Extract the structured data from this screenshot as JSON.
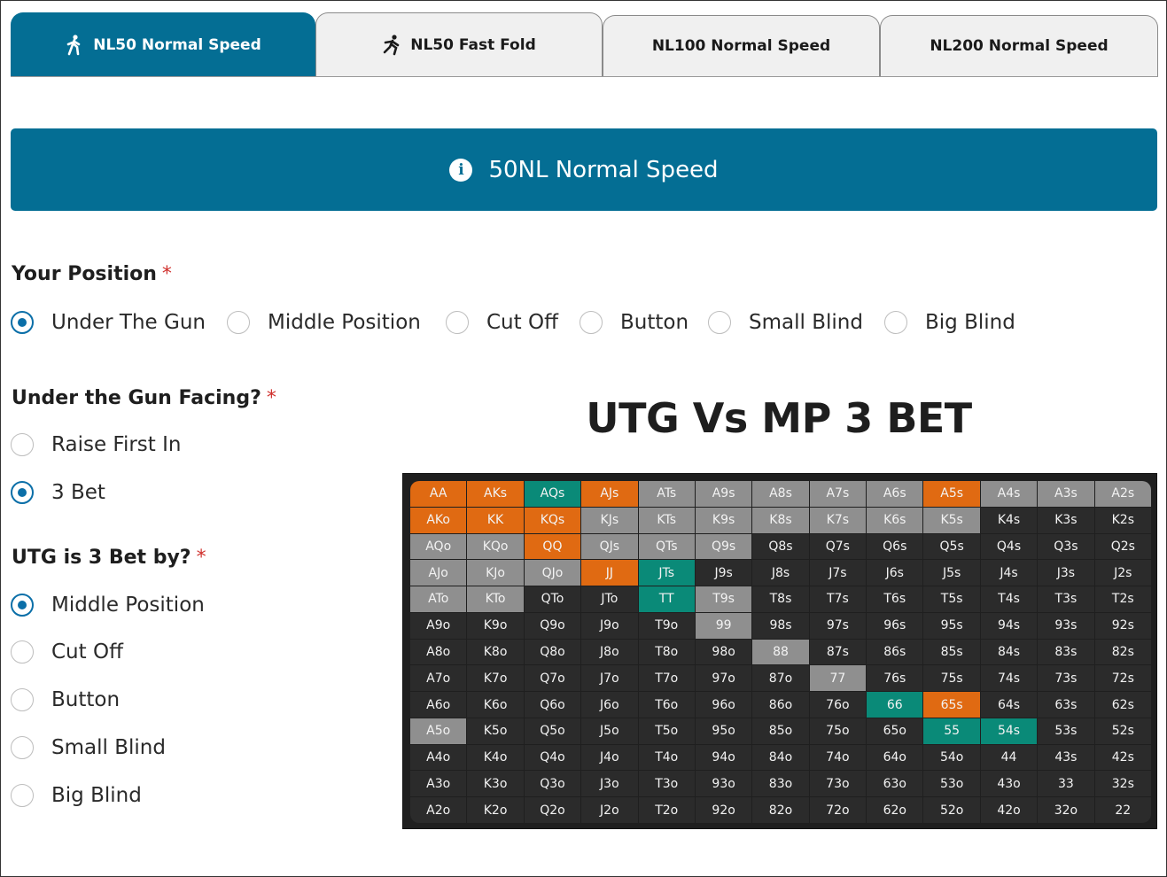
{
  "tabs": [
    {
      "label": "NL50 Normal Speed",
      "icon": "walking-person-icon",
      "active": true
    },
    {
      "label": "NL50 Fast Fold",
      "icon": "running-person-icon",
      "active": false
    },
    {
      "label": "NL100 Normal Speed",
      "active": false
    },
    {
      "label": "NL200 Normal Speed",
      "active": false
    }
  ],
  "banner": {
    "text": "50NL Normal Speed",
    "icon": "info-icon"
  },
  "position": {
    "label": "Your Position",
    "required": "*",
    "options": [
      "Under The Gun",
      "Middle Position",
      "Cut Off",
      "Button",
      "Small Blind",
      "Big Blind"
    ],
    "selected": "Under The Gun"
  },
  "facing": {
    "label": "Under the Gun Facing?",
    "required": "*",
    "options": [
      "Raise First In",
      "3 Bet"
    ],
    "selected": "3 Bet"
  },
  "threebet_by": {
    "label": "UTG is 3 Bet by?",
    "required": "*",
    "options": [
      "Middle Position",
      "Cut Off",
      "Button",
      "Small Blind",
      "Big Blind"
    ],
    "selected": "Middle Position"
  },
  "chart": {
    "title": "UTG Vs MP 3 BET",
    "colors": {
      "default": "#2b2b2b",
      "gray": "#8f8f8f",
      "orange": "#e06a12",
      "teal": "#0a8a78"
    },
    "rows": [
      [
        "AA",
        "AKs",
        "AQs",
        "AJs",
        "ATs",
        "A9s",
        "A8s",
        "A7s",
        "A6s",
        "A5s",
        "A4s",
        "A3s",
        "A2s"
      ],
      [
        "AKo",
        "KK",
        "KQs",
        "KJs",
        "KTs",
        "K9s",
        "K8s",
        "K7s",
        "K6s",
        "K5s",
        "K4s",
        "K3s",
        "K2s"
      ],
      [
        "AQo",
        "KQo",
        "QQ",
        "QJs",
        "QTs",
        "Q9s",
        "Q8s",
        "Q7s",
        "Q6s",
        "Q5s",
        "Q4s",
        "Q3s",
        "Q2s"
      ],
      [
        "AJo",
        "KJo",
        "QJo",
        "JJ",
        "JTs",
        "J9s",
        "J8s",
        "J7s",
        "J6s",
        "J5s",
        "J4s",
        "J3s",
        "J2s"
      ],
      [
        "ATo",
        "KTo",
        "QTo",
        "JTo",
        "TT",
        "T9s",
        "T8s",
        "T7s",
        "T6s",
        "T5s",
        "T4s",
        "T3s",
        "T2s"
      ],
      [
        "A9o",
        "K9o",
        "Q9o",
        "J9o",
        "T9o",
        "99",
        "98s",
        "97s",
        "96s",
        "95s",
        "94s",
        "93s",
        "92s"
      ],
      [
        "A8o",
        "K8o",
        "Q8o",
        "J8o",
        "T8o",
        "98o",
        "88",
        "87s",
        "86s",
        "85s",
        "84s",
        "83s",
        "82s"
      ],
      [
        "A7o",
        "K7o",
        "Q7o",
        "J7o",
        "T7o",
        "97o",
        "87o",
        "77",
        "76s",
        "75s",
        "74s",
        "73s",
        "72s"
      ],
      [
        "A6o",
        "K6o",
        "Q6o",
        "J6o",
        "T6o",
        "96o",
        "86o",
        "76o",
        "66",
        "65s",
        "64s",
        "63s",
        "62s"
      ],
      [
        "A5o",
        "K5o",
        "Q5o",
        "J5o",
        "T5o",
        "95o",
        "85o",
        "75o",
        "65o",
        "55",
        "54s",
        "53s",
        "52s"
      ],
      [
        "A4o",
        "K4o",
        "Q4o",
        "J4o",
        "T4o",
        "94o",
        "84o",
        "74o",
        "64o",
        "54o",
        "44",
        "43s",
        "42s"
      ],
      [
        "A3o",
        "K3o",
        "Q3o",
        "J3o",
        "T3o",
        "93o",
        "83o",
        "73o",
        "63o",
        "53o",
        "43o",
        "33",
        "32s"
      ],
      [
        "A2o",
        "K2o",
        "Q2o",
        "J2o",
        "T2o",
        "92o",
        "82o",
        "72o",
        "62o",
        "52o",
        "42o",
        "32o",
        "22"
      ]
    ],
    "cell_colors": [
      [
        "orange",
        "orange",
        "teal",
        "orange",
        "gray",
        "gray",
        "gray",
        "gray",
        "gray",
        "orange",
        "gray",
        "gray",
        "gray"
      ],
      [
        "orange",
        "orange",
        "orange",
        "gray",
        "gray",
        "gray",
        "gray",
        "gray",
        "gray",
        "gray",
        "default",
        "default",
        "default"
      ],
      [
        "gray",
        "gray",
        "orange",
        "gray",
        "gray",
        "gray",
        "default",
        "default",
        "default",
        "default",
        "default",
        "default",
        "default"
      ],
      [
        "gray",
        "gray",
        "gray",
        "orange",
        "teal",
        "default",
        "default",
        "default",
        "default",
        "default",
        "default",
        "default",
        "default"
      ],
      [
        "gray",
        "gray",
        "default",
        "default",
        "teal",
        "gray",
        "default",
        "default",
        "default",
        "default",
        "default",
        "default",
        "default"
      ],
      [
        "default",
        "default",
        "default",
        "default",
        "default",
        "gray",
        "default",
        "default",
        "default",
        "default",
        "default",
        "default",
        "default"
      ],
      [
        "default",
        "default",
        "default",
        "default",
        "default",
        "default",
        "gray",
        "default",
        "default",
        "default",
        "default",
        "default",
        "default"
      ],
      [
        "default",
        "default",
        "default",
        "default",
        "default",
        "default",
        "default",
        "gray",
        "default",
        "default",
        "default",
        "default",
        "default"
      ],
      [
        "default",
        "default",
        "default",
        "default",
        "default",
        "default",
        "default",
        "default",
        "teal",
        "orange",
        "default",
        "default",
        "default"
      ],
      [
        "gray",
        "default",
        "default",
        "default",
        "default",
        "default",
        "default",
        "default",
        "default",
        "teal",
        "teal",
        "default",
        "default"
      ],
      [
        "default",
        "default",
        "default",
        "default",
        "default",
        "default",
        "default",
        "default",
        "default",
        "default",
        "default",
        "default",
        "default"
      ],
      [
        "default",
        "default",
        "default",
        "default",
        "default",
        "default",
        "default",
        "default",
        "default",
        "default",
        "default",
        "default",
        "default"
      ],
      [
        "default",
        "default",
        "default",
        "default",
        "default",
        "default",
        "default",
        "default",
        "default",
        "default",
        "default",
        "default",
        "default"
      ]
    ]
  }
}
